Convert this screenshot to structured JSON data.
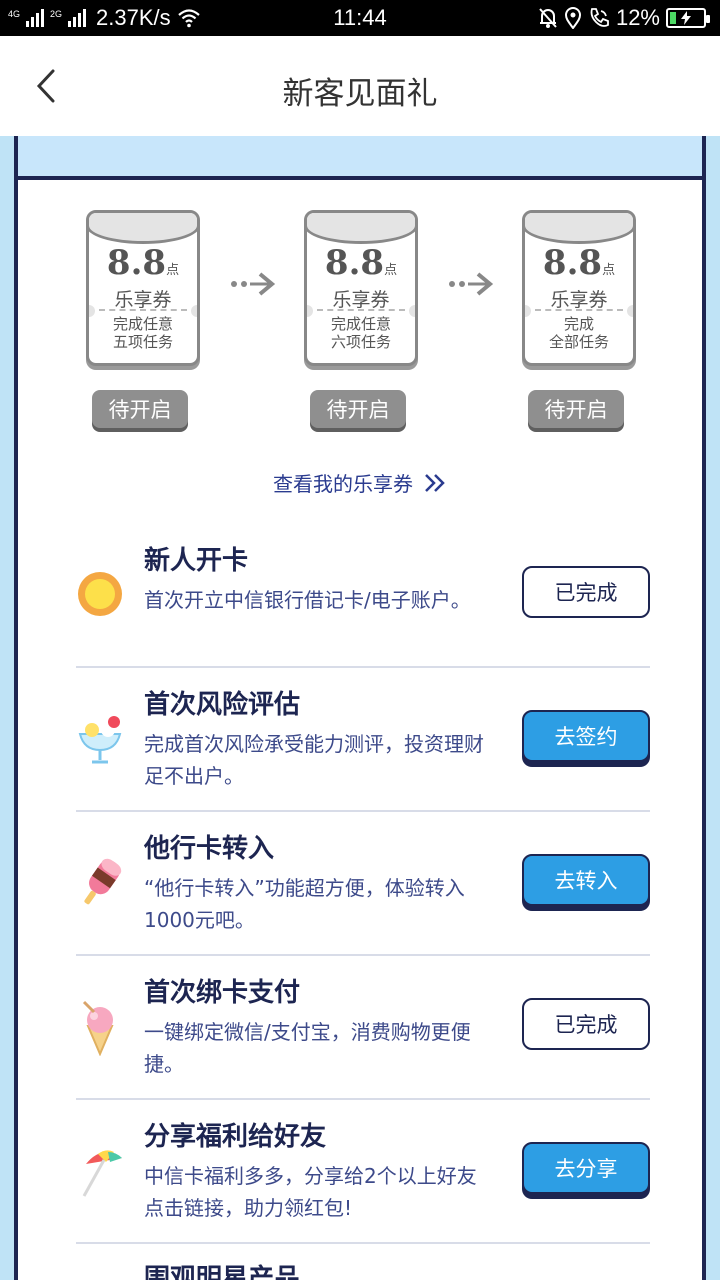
{
  "status_bar": {
    "net1": "4G",
    "net2": "2G",
    "speed": "2.37K/s",
    "time": "11:44",
    "battery": "12%"
  },
  "header": {
    "title": "新客见面礼"
  },
  "coupons": [
    {
      "amount": "8.8",
      "unit": "点",
      "name": "乐享券",
      "desc_line1": "完成任意",
      "desc_line2": "五项任务",
      "status": "待开启"
    },
    {
      "amount": "8.8",
      "unit": "点",
      "name": "乐享券",
      "desc_line1": "完成任意",
      "desc_line2": "六项任务",
      "status": "待开启"
    },
    {
      "amount": "8.8",
      "unit": "点",
      "name": "乐享券",
      "desc_line1": "完成",
      "desc_line2": "全部任务",
      "status": "待开启"
    }
  ],
  "view_link": "查看我的乐享券",
  "tasks": [
    {
      "icon": "sun-icon",
      "title": "新人开卡",
      "desc": "首次开立中信银行借记卡/电子账户。",
      "button": "已完成",
      "state": "done"
    },
    {
      "icon": "sundae-icon",
      "title": "首次风险评估",
      "desc": "完成首次风险承受能力测评，投资理财足不出户。",
      "button": "去签约",
      "state": "go"
    },
    {
      "icon": "popsicle-icon",
      "title": "他行卡转入",
      "desc": "“他行卡转入”功能超方便，体验转入1000元吧。",
      "button": "去转入",
      "state": "go"
    },
    {
      "icon": "ice-cream-cone-icon",
      "title": "首次绑卡支付",
      "desc": "一键绑定微信/支付宝，消费购物更便捷。",
      "button": "已完成",
      "state": "done"
    },
    {
      "icon": "beach-umbrella-icon",
      "title": "分享福利给好友",
      "desc": "中信卡福利多多，分享给2个以上好友点击链接，助力领红包!",
      "button": "去分享",
      "state": "go"
    }
  ],
  "partial_task_title": "围观明星产品"
}
